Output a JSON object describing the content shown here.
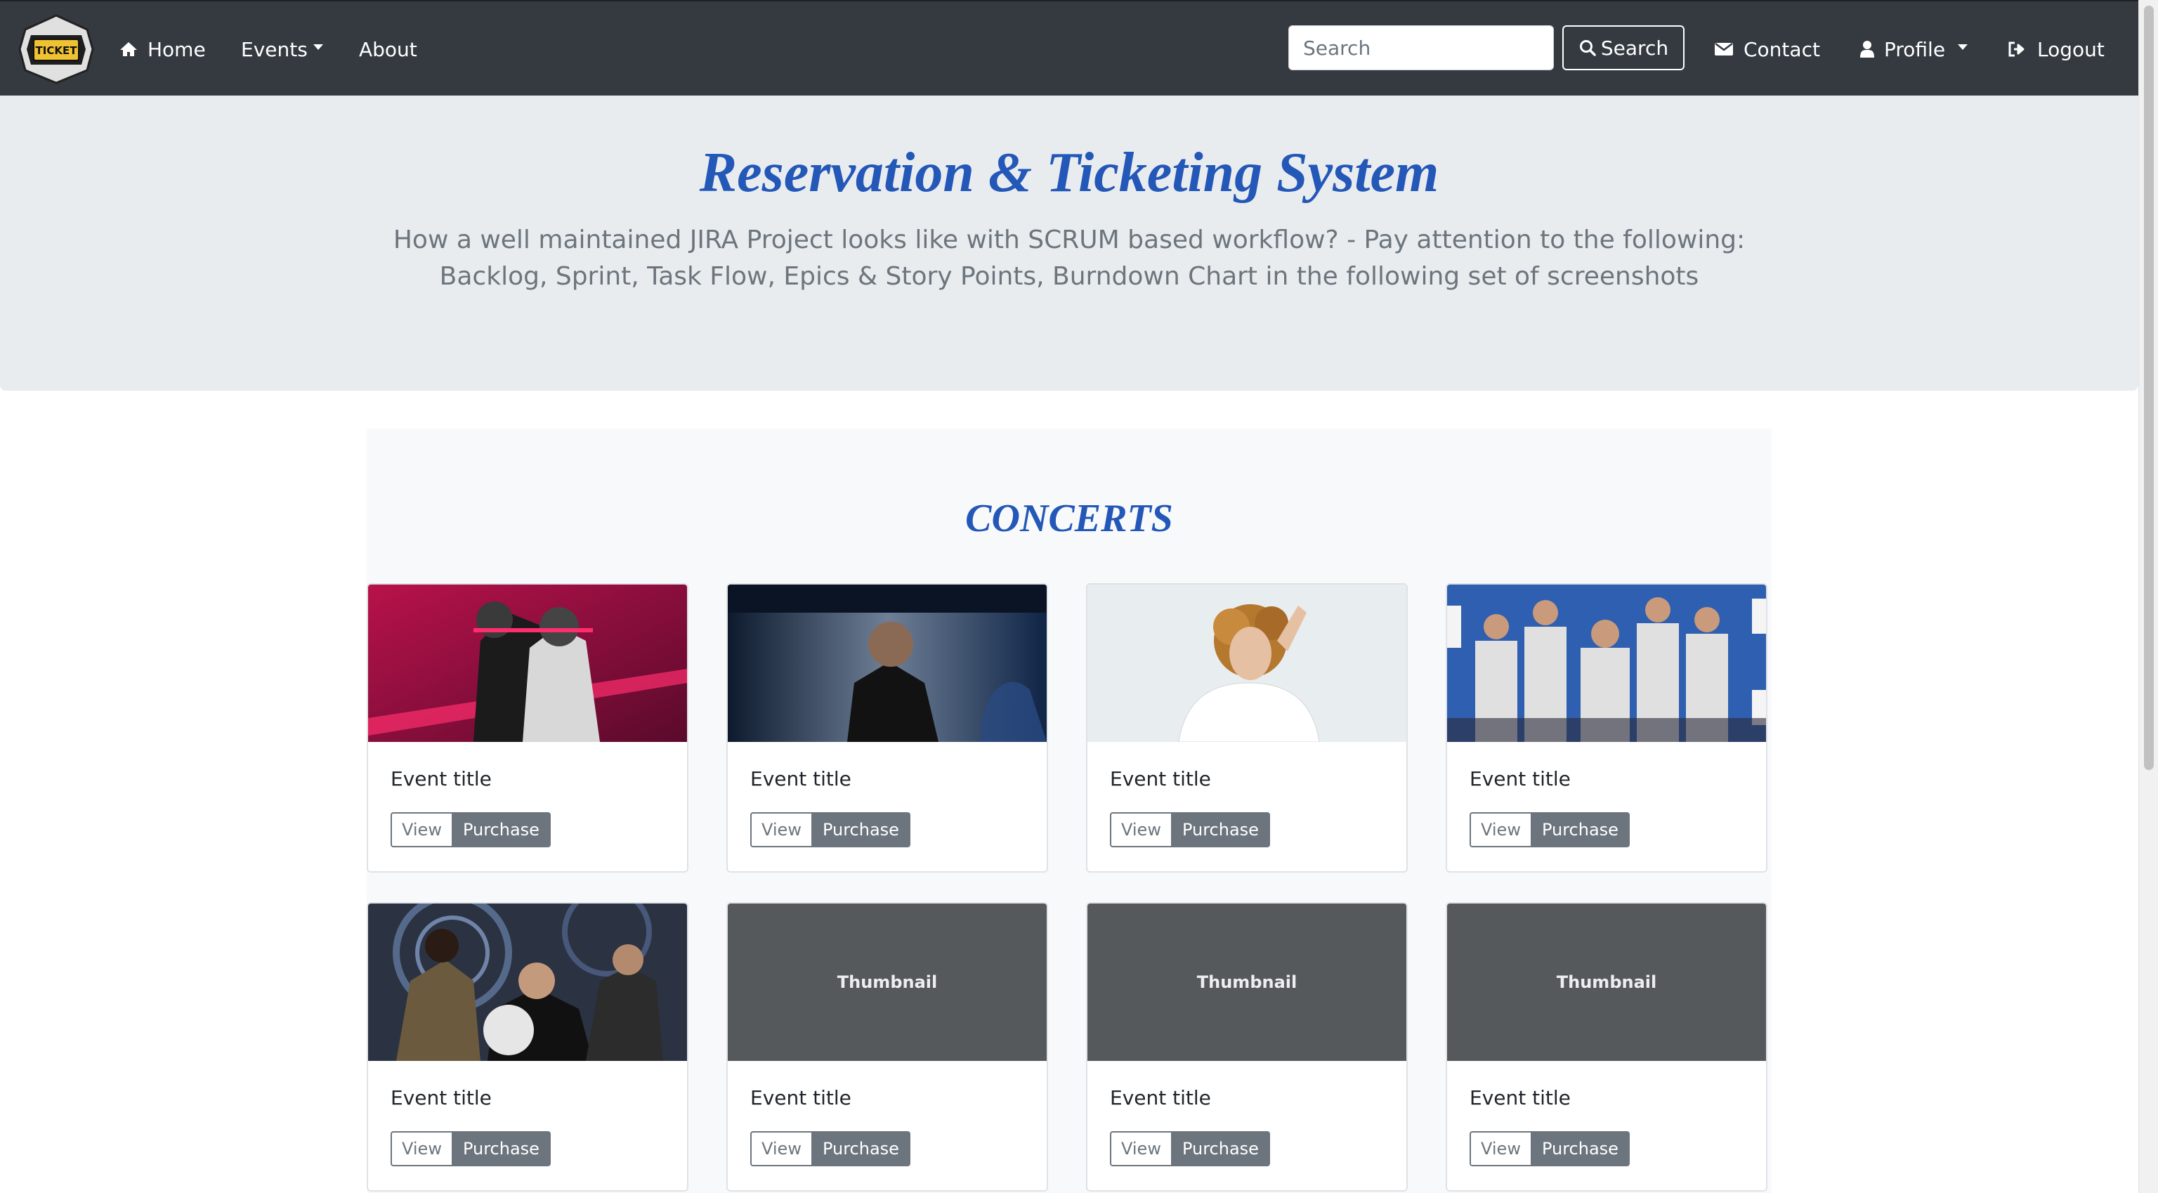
{
  "navbar": {
    "brand_text": "TICKET",
    "home_label": "Home",
    "events_label": "Events",
    "about_label": "About",
    "search_placeholder": "Search",
    "search_button_label": "Search",
    "contact_label": "Contact",
    "profile_label": "Profile",
    "logout_label": "Logout"
  },
  "hero": {
    "title": "Reservation & Ticketing System",
    "lead": "How a well maintained JIRA Project looks like with SCRUM based workflow? - Pay attention to the following: Backlog, Sprint, Task Flow, Epics & Story Points, Burndown Chart in the following set of screenshots"
  },
  "section": {
    "title": "CONCERTS"
  },
  "cards": [
    {
      "title": "Event title",
      "view_label": "View",
      "purchase_label": "Purchase",
      "image": "band-photo-pink"
    },
    {
      "title": "Event title",
      "view_label": "View",
      "purchase_label": "Purchase",
      "image": "artist-photo-dark"
    },
    {
      "title": "Event title",
      "view_label": "View",
      "purchase_label": "Purchase",
      "image": "singer-photo-light"
    },
    {
      "title": "Event title",
      "view_label": "View",
      "purchase_label": "Purchase",
      "image": "band-photo-blue"
    },
    {
      "title": "Event title",
      "view_label": "View",
      "purchase_label": "Purchase",
      "image": "band-photo-gear"
    },
    {
      "title": "Event title",
      "view_label": "View",
      "purchase_label": "Purchase",
      "thumbnail_text": "Thumbnail"
    },
    {
      "title": "Event title",
      "view_label": "View",
      "purchase_label": "Purchase",
      "thumbnail_text": "Thumbnail"
    },
    {
      "title": "Event title",
      "view_label": "View",
      "purchase_label": "Purchase",
      "thumbnail_text": "Thumbnail"
    }
  ],
  "colors": {
    "navbar_bg": "#343a40",
    "jumbotron_bg": "#e9ecef",
    "heading_blue": "#2357b8",
    "thumbnail_bg": "#55595c",
    "button_gray": "#6c757d"
  }
}
